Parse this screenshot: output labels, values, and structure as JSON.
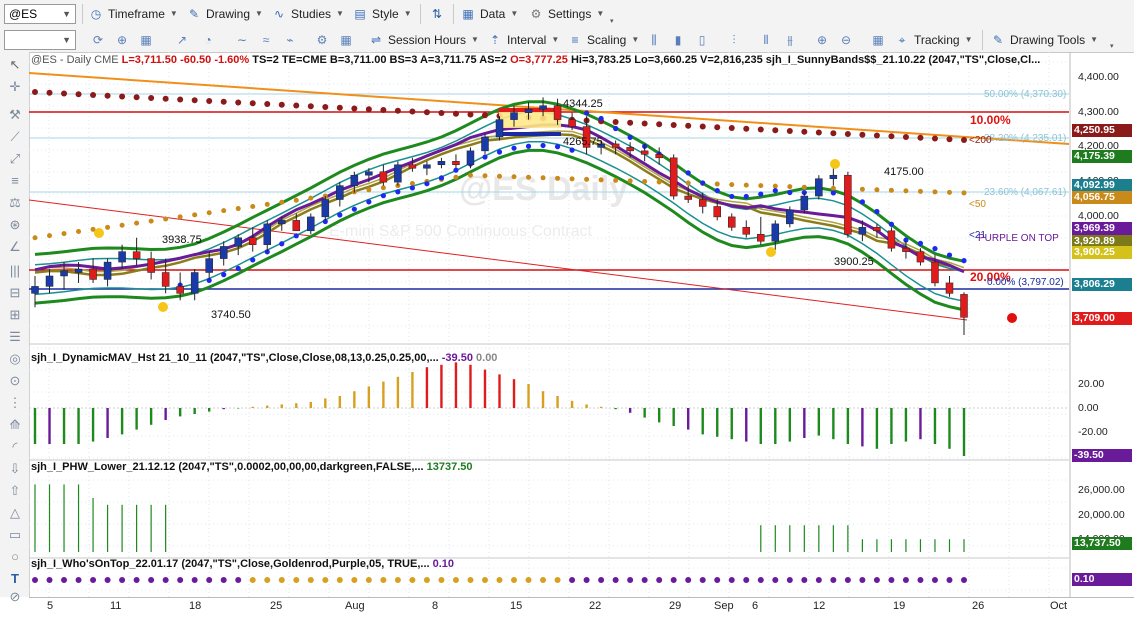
{
  "toolbar": {
    "symbol": "@ES",
    "timeframe": "Timeframe",
    "drawing": "Drawing",
    "studies": "Studies",
    "style": "Style",
    "data": "Data",
    "settings": "Settings",
    "session_hours": "Session Hours",
    "interval": "Interval",
    "scaling": "Scaling",
    "tracking": "Tracking",
    "drawing_tools": "Drawing Tools"
  },
  "header": {
    "prefix": "@ES - Daily  CME",
    "last": "L=3,711.50",
    "chg": "-60.50",
    "pct": "-1.60%",
    "ts": "TS=2  TE=CME  B=3,711.00  BS=3  A=3,711.75  AS=2",
    "open": "O=3,777.25",
    "rest": "Hi=3,783.25  Lo=3,660.25  V=2,816,235  sjh_I_SunnyBands$$_21.10.22 (2047,\"TS\",Close,Cl..."
  },
  "watermark": "@ES Daily",
  "watermark_sub": "E-mini S&P 500 Continuous Contract",
  "annotations": {
    "hi_4344": "4344.25",
    "lo_4265": "4265.75",
    "hi_4175": "4175.00",
    "lo_3938": "3938.75",
    "lo_3740": "3740.50",
    "lo_3900": "3900.25",
    "pct10": "10.00%",
    "pct20": "20.00%",
    "fib50": "50.00% (4,370.30)",
    "fib38": "38.20% (4,235.01)",
    "fib23": "23.60% (4,067.61)",
    "fib0": "0.00% (3,797.02)",
    "ma200": "<200",
    "ma50": "<50",
    "ma21": "<21",
    "purple_top": "PURPLE ON TOP"
  },
  "price_axis": {
    "ticks": [
      "4,400.00",
      "4,300.00",
      "4,200.00",
      "4,100.00",
      "4,000.00",
      "3,900.00",
      "3,800.00",
      "3,700.00"
    ],
    "boxes": [
      {
        "label": "4,250.95",
        "color": "#8b1a1a"
      },
      {
        "label": "4,175.39",
        "color": "#1e7b1e"
      },
      {
        "label": "4,092.99",
        "color": "#1b7f8f"
      },
      {
        "label": "4,056.75",
        "color": "#c98a1a"
      },
      {
        "label": "3,969.39",
        "color": "#6a1b9a"
      },
      {
        "label": "3,929.89",
        "color": "#7d7a1a"
      },
      {
        "label": "3,900.25",
        "color": "#d4c21a"
      },
      {
        "label": "3,806.29",
        "color": "#1b7f8f"
      },
      {
        "label": "3,709.00",
        "color": "#e01b1b"
      }
    ]
  },
  "panes": {
    "mav": {
      "title": "sjh_I_DynamicMAV_Hst 21_10_11 (2047,\"TS\",Close,Close,08,13,0.25,0.25,00,...",
      "value": "-39.50",
      "value2": "0.00",
      "ticks": [
        "20.00",
        "0.00",
        "-20.00"
      ],
      "box": "-39.50"
    },
    "phw": {
      "title": "sjh_I_PHW_Lower_21.12.12 (2047,\"TS\",0.0002,00,00,00,darkgreen,FALSE,...",
      "value": "13737.50",
      "ticks": [
        "26,000.00",
        "20,000.00",
        "14,000.00"
      ],
      "box": "13,737.50"
    },
    "wot": {
      "title": "sjh_I_Who'sOnTop_22.01.17 (2047,\"TS\",Close,Goldenrod,Purple,05, TRUE,...",
      "value": "0.10",
      "box": "0.10"
    }
  },
  "x_axis": [
    "5",
    "11",
    "18",
    "25",
    "Aug",
    "8",
    "15",
    "22",
    "29",
    "Sep",
    "6",
    "12",
    "19",
    "26",
    "Oct"
  ],
  "chart_data": {
    "type": "candlestick",
    "ylim": [
      3640,
      4440
    ],
    "candles": [
      {
        "o": 3780,
        "h": 3830,
        "l": 3740,
        "c": 3800
      },
      {
        "o": 3800,
        "h": 3850,
        "l": 3780,
        "c": 3830
      },
      {
        "o": 3830,
        "h": 3870,
        "l": 3790,
        "c": 3845
      },
      {
        "o": 3840,
        "h": 3870,
        "l": 3810,
        "c": 3850
      },
      {
        "o": 3850,
        "h": 3880,
        "l": 3810,
        "c": 3820
      },
      {
        "o": 3820,
        "h": 3880,
        "l": 3800,
        "c": 3870
      },
      {
        "o": 3870,
        "h": 3920,
        "l": 3850,
        "c": 3900
      },
      {
        "o": 3900,
        "h": 3940,
        "l": 3860,
        "c": 3880
      },
      {
        "o": 3880,
        "h": 3900,
        "l": 3820,
        "c": 3840
      },
      {
        "o": 3840,
        "h": 3880,
        "l": 3780,
        "c": 3800
      },
      {
        "o": 3800,
        "h": 3840,
        "l": 3760,
        "c": 3780
      },
      {
        "o": 3780,
        "h": 3850,
        "l": 3760,
        "c": 3840
      },
      {
        "o": 3840,
        "h": 3900,
        "l": 3820,
        "c": 3880
      },
      {
        "o": 3880,
        "h": 3930,
        "l": 3860,
        "c": 3915
      },
      {
        "o": 3915,
        "h": 3950,
        "l": 3890,
        "c": 3940
      },
      {
        "o": 3940,
        "h": 3970,
        "l": 3900,
        "c": 3920
      },
      {
        "o": 3920,
        "h": 3990,
        "l": 3900,
        "c": 3980
      },
      {
        "o": 3980,
        "h": 4000,
        "l": 3960,
        "c": 3990
      },
      {
        "o": 3990,
        "h": 4010,
        "l": 3970,
        "c": 3960
      },
      {
        "o": 3960,
        "h": 4010,
        "l": 3950,
        "c": 4000
      },
      {
        "o": 4000,
        "h": 4060,
        "l": 3990,
        "c": 4050
      },
      {
        "o": 4050,
        "h": 4100,
        "l": 4030,
        "c": 4090
      },
      {
        "o": 4090,
        "h": 4130,
        "l": 4070,
        "c": 4120
      },
      {
        "o": 4120,
        "h": 4140,
        "l": 4100,
        "c": 4130
      },
      {
        "o": 4130,
        "h": 4150,
        "l": 4090,
        "c": 4100
      },
      {
        "o": 4100,
        "h": 4160,
        "l": 4090,
        "c": 4150
      },
      {
        "o": 4150,
        "h": 4170,
        "l": 4130,
        "c": 4140
      },
      {
        "o": 4140,
        "h": 4160,
        "l": 4120,
        "c": 4150
      },
      {
        "o": 4150,
        "h": 4170,
        "l": 4140,
        "c": 4160
      },
      {
        "o": 4160,
        "h": 4180,
        "l": 4140,
        "c": 4150
      },
      {
        "o": 4150,
        "h": 4200,
        "l": 4140,
        "c": 4190
      },
      {
        "o": 4190,
        "h": 4240,
        "l": 4180,
        "c": 4230
      },
      {
        "o": 4230,
        "h": 4290,
        "l": 4220,
        "c": 4280
      },
      {
        "o": 4280,
        "h": 4320,
        "l": 4260,
        "c": 4300
      },
      {
        "o": 4300,
        "h": 4330,
        "l": 4280,
        "c": 4310
      },
      {
        "o": 4310,
        "h": 4344,
        "l": 4290,
        "c": 4320
      },
      {
        "o": 4320,
        "h": 4340,
        "l": 4265,
        "c": 4280
      },
      {
        "o": 4280,
        "h": 4300,
        "l": 4250,
        "c": 4260
      },
      {
        "o": 4260,
        "h": 4290,
        "l": 4180,
        "c": 4200
      },
      {
        "o": 4200,
        "h": 4220,
        "l": 4180,
        "c": 4210
      },
      {
        "o": 4210,
        "h": 4220,
        "l": 4180,
        "c": 4200
      },
      {
        "o": 4200,
        "h": 4215,
        "l": 4170,
        "c": 4190
      },
      {
        "o": 4190,
        "h": 4210,
        "l": 4160,
        "c": 4180
      },
      {
        "o": 4180,
        "h": 4200,
        "l": 4150,
        "c": 4170
      },
      {
        "o": 4170,
        "h": 4180,
        "l": 4050,
        "c": 4060
      },
      {
        "o": 4060,
        "h": 4090,
        "l": 4040,
        "c": 4050
      },
      {
        "o": 4050,
        "h": 4070,
        "l": 4010,
        "c": 4030
      },
      {
        "o": 4030,
        "h": 4050,
        "l": 3990,
        "c": 4000
      },
      {
        "o": 4000,
        "h": 4010,
        "l": 3960,
        "c": 3970
      },
      {
        "o": 3970,
        "h": 3990,
        "l": 3940,
        "c": 3950
      },
      {
        "o": 3950,
        "h": 4000,
        "l": 3920,
        "c": 3930
      },
      {
        "o": 3930,
        "h": 3990,
        "l": 3905,
        "c": 3980
      },
      {
        "o": 3980,
        "h": 4030,
        "l": 3970,
        "c": 4020
      },
      {
        "o": 4020,
        "h": 4070,
        "l": 4010,
        "c": 4060
      },
      {
        "o": 4060,
        "h": 4120,
        "l": 4050,
        "c": 4110
      },
      {
        "o": 4110,
        "h": 4150,
        "l": 4090,
        "c": 4120
      },
      {
        "o": 4120,
        "h": 4130,
        "l": 3940,
        "c": 3950
      },
      {
        "o": 3950,
        "h": 3990,
        "l": 3930,
        "c": 3970
      },
      {
        "o": 3970,
        "h": 3980,
        "l": 3940,
        "c": 3960
      },
      {
        "o": 3960,
        "h": 3970,
        "l": 3900,
        "c": 3910
      },
      {
        "o": 3910,
        "h": 3930,
        "l": 3880,
        "c": 3900
      },
      {
        "o": 3900,
        "h": 3910,
        "l": 3860,
        "c": 3870
      },
      {
        "o": 3870,
        "h": 3890,
        "l": 3800,
        "c": 3810
      },
      {
        "o": 3810,
        "h": 3830,
        "l": 3770,
        "c": 3780
      },
      {
        "o": 3777,
        "h": 3783,
        "l": 3660,
        "c": 3711
      }
    ],
    "mav_hist": [
      -30,
      -30,
      -30,
      -30,
      -28,
      -25,
      -22,
      -18,
      -14,
      -10,
      -7,
      -5,
      -3,
      -1,
      0,
      1,
      2,
      3,
      4,
      5,
      8,
      10,
      14,
      18,
      22,
      26,
      30,
      34,
      36,
      38,
      36,
      32,
      28,
      24,
      20,
      14,
      10,
      6,
      3,
      1,
      -1,
      -4,
      -8,
      -12,
      -15,
      -18,
      -22,
      -24,
      -26,
      -28,
      -30,
      -30,
      -28,
      -25,
      -23,
      -26,
      -30,
      -32,
      -34,
      -30,
      -28,
      -26,
      -30,
      -34,
      -40
    ],
    "phw_hist": [
      26000,
      26000,
      26000,
      26000,
      22000,
      20000,
      20000,
      20000,
      20000,
      20000,
      16000,
      15000,
      14500,
      14200,
      14000,
      14000,
      14000,
      14000,
      14000,
      14000,
      14000,
      14000,
      14000,
      14000,
      14000,
      14000,
      14000,
      14000,
      14000,
      14000,
      14000,
      14000,
      14000,
      14000,
      14000,
      14000,
      14000,
      14000,
      14000,
      14000,
      14000,
      14000,
      14000,
      14000,
      14000,
      14000,
      14000,
      14000,
      14000,
      14000,
      14000,
      14000,
      14000,
      14000,
      14000,
      14000,
      14000,
      14000,
      14000,
      14000,
      14000,
      14000,
      14000,
      14000,
      14000
    ]
  }
}
